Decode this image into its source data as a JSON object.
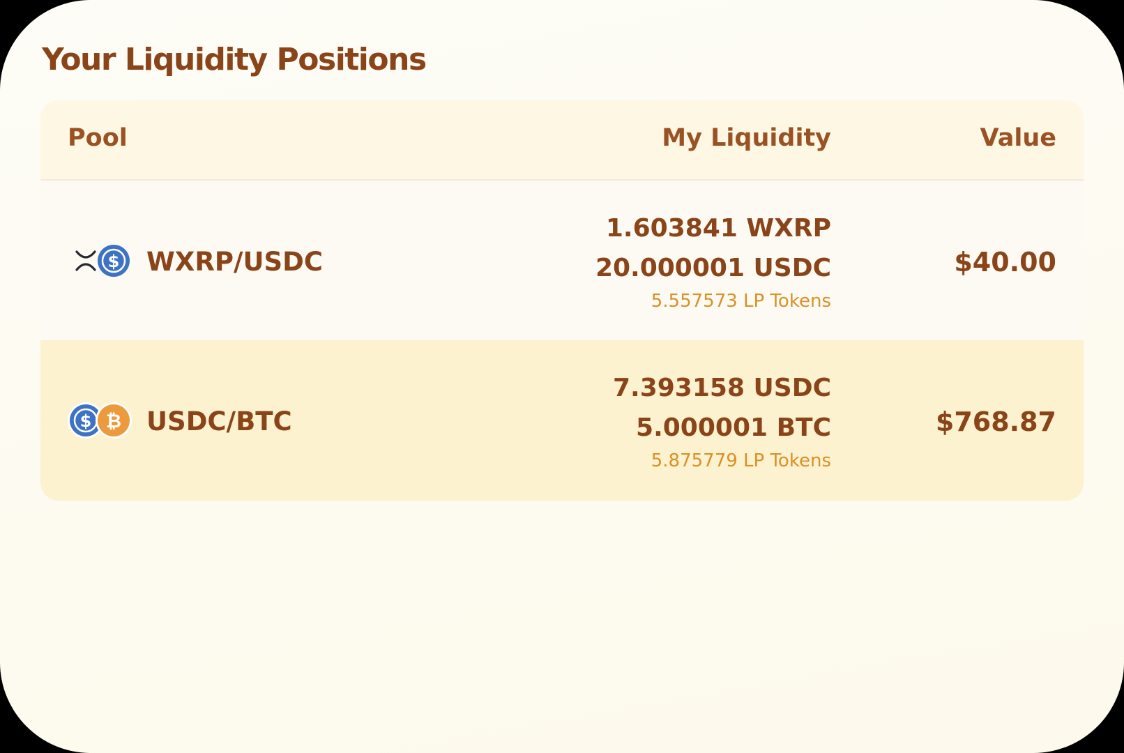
{
  "title": "Your Liquidity Positions",
  "table": {
    "headers": {
      "pool": "Pool",
      "liquidity": "My Liquidity",
      "value": "Value"
    },
    "rows": [
      {
        "pair": "WXRP/USDC",
        "token_a_amount": "1.603841 WXRP",
        "token_b_amount": "20.000001 USDC",
        "lp_tokens": "5.557573 LP Tokens",
        "value": "$40.00"
      },
      {
        "pair": "USDC/BTC",
        "token_a_amount": "7.393158 USDC",
        "token_b_amount": "5.000001 BTC",
        "lp_tokens": "5.875779 LP Tokens",
        "value": "$768.87"
      }
    ]
  },
  "icons": {
    "xrp": "xrp-icon",
    "usdc": "usdc-icon",
    "btc": "btc-icon"
  },
  "colors": {
    "accent_text": "#8a4419",
    "lp_text": "#d99128",
    "usdc_blue": "#3e73c4",
    "btc_orange": "#ec9a3c",
    "highlight_row": "#fcf2cf"
  }
}
